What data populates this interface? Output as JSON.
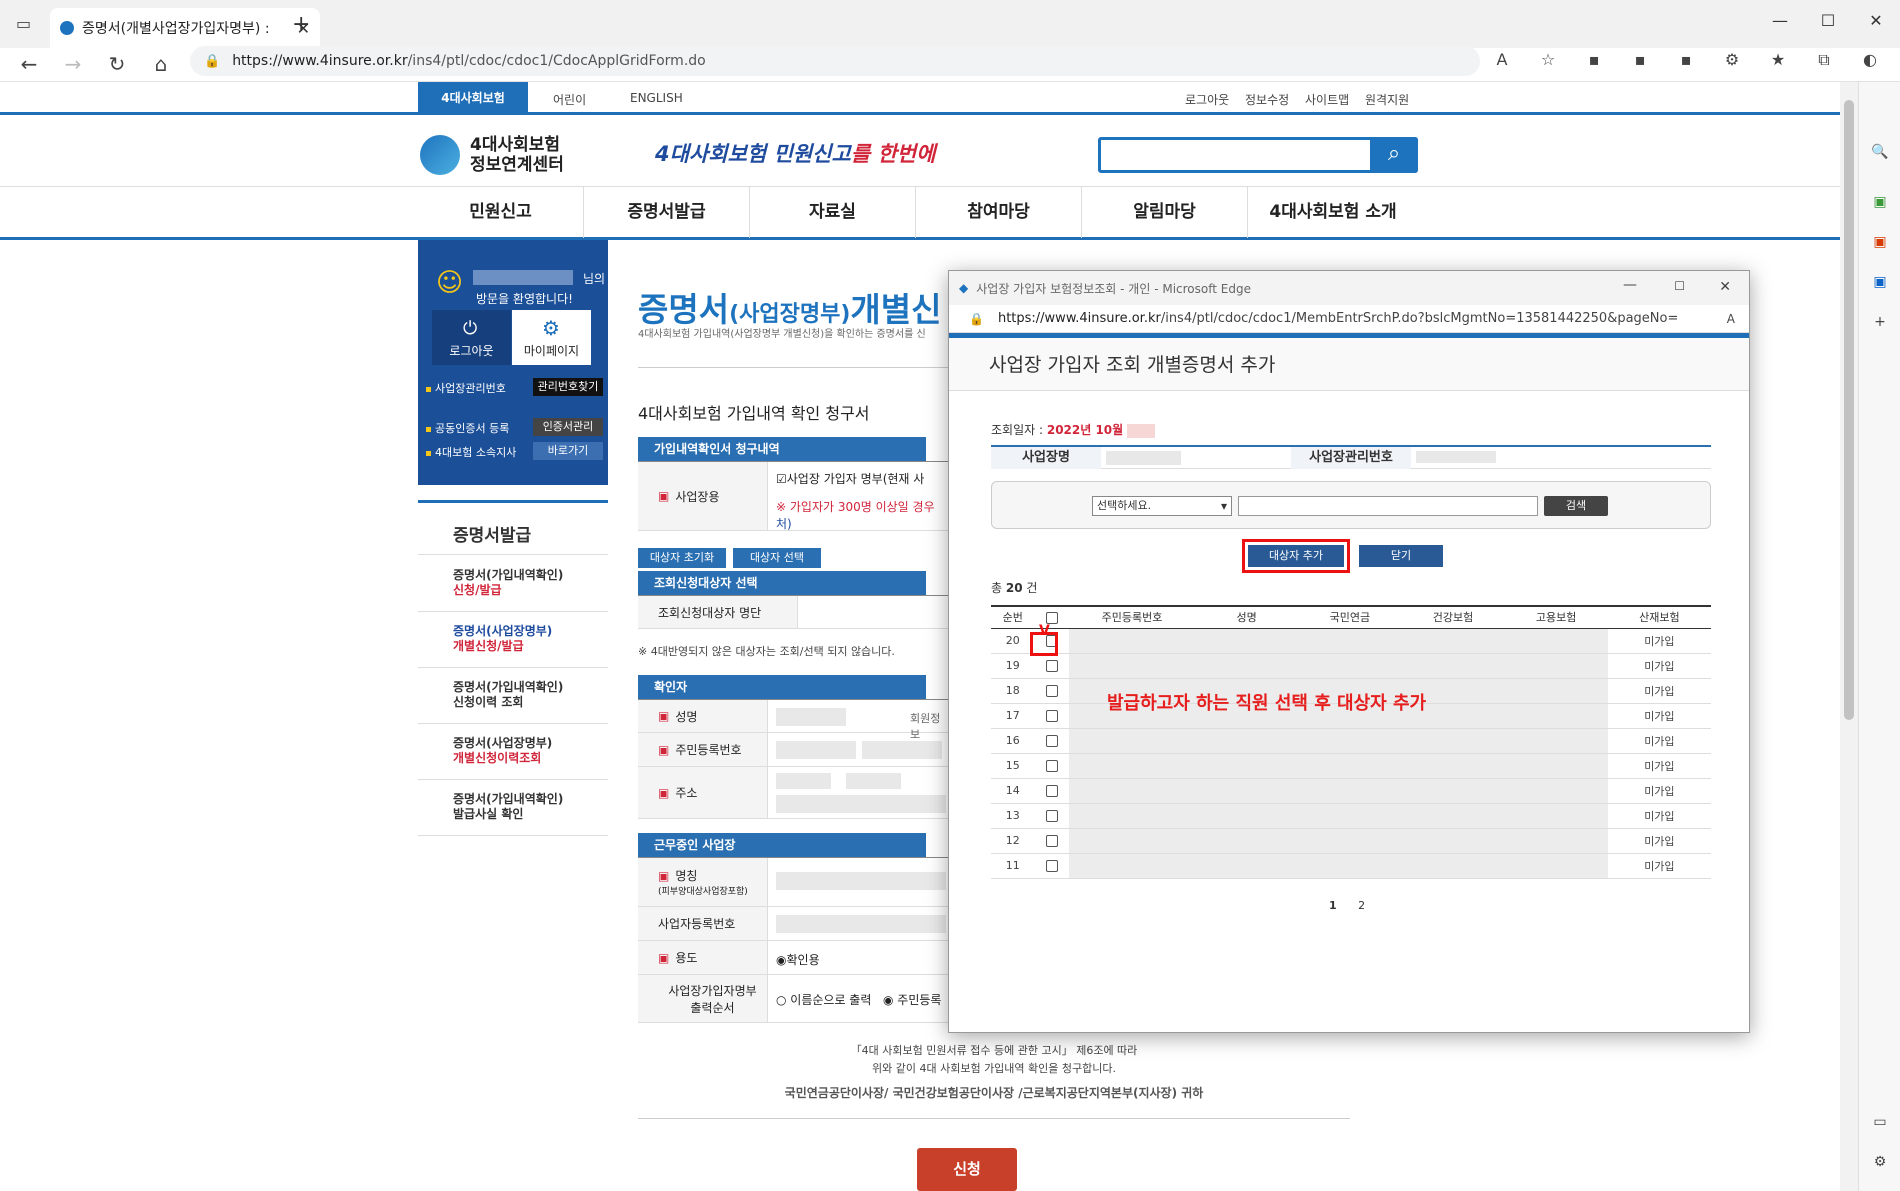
{
  "browser": {
    "tab_title": "증명서(개별사업장가입자명부) :",
    "url_host": "https://www.4insure.or.kr",
    "url_path": "/ins4/ptl/cdoc/cdoc1/CdocApplGridForm.do"
  },
  "site": {
    "top_tab": "4대사회보험",
    "top_link_kids": "어린이",
    "top_link_english": "ENGLISH",
    "top_right": [
      "로그아웃",
      "정보수정",
      "사이트맵",
      "원격지원"
    ],
    "logo_line1": "4대사회보험",
    "logo_line2": "정보연계센터",
    "slogan_main": "4대사회보험 민원신고",
    "slogan_suffix": "를 한번에",
    "nav": [
      "민원신고",
      "증명서발급",
      "자료실",
      "참여마당",
      "알림마당",
      "4대사회보험 소개"
    ]
  },
  "sidebar": {
    "suffix": "님의",
    "welcome": "방문을 환영합니다!",
    "logout_btn": "로그아웃",
    "mypage_btn": "마이페이지",
    "row1": "사업장관리번호",
    "row1_badge": "관리번호찾기",
    "row2": "공동인증서 등록",
    "row2_badge": "인증서관리",
    "row3": "4대보험 소속지사",
    "row3_badge": "바로가기",
    "menu_title": "증명서발급",
    "menu": [
      {
        "line1": "증명서(가입내역확인)",
        "line2": "신청/발급"
      },
      {
        "line1": "증명서(사업장명부)",
        "line2": "개별신청/발급"
      },
      {
        "line1": "증명서(가입내역확인)",
        "line2": "신청이력 조회"
      },
      {
        "line1": "증명서(사업장명부)",
        "line2": "개별신청이력조회"
      },
      {
        "line1": "증명서(가입내역확인)",
        "line2": "발급사실 확인"
      }
    ]
  },
  "main": {
    "title_big": "증명서",
    "title_small": "(사업장명부)",
    "title_rest": "개별신",
    "desc": "4대사회보험 가입내역(사업장명부 개별신청)을 확인하는 증명서를 신",
    "form_title": "4대사회보험 가입내역 확인 청구서",
    "sect1": "가입내역확인서 청구내역",
    "usage_label": "사업장용",
    "usage_check": "사업장 가입자 명부(현재 사",
    "usage_warn": "※ 가입자가 300명 이상일 경우",
    "usage_warn2": "처)",
    "btn_reset": "대상자 초기화",
    "btn_select": "대상자 선택",
    "sect2": "조회신청대상자 선택",
    "list_label": "조회신청대상자 명단",
    "note": "※ 4대반영되지 않은 대상자는 조회/선택 되지 않습니다.",
    "sect3": "확인자",
    "name_label": "성명",
    "name_extra": "회원정보",
    "rrn_label": "주민등록번호",
    "addr_label": "주소",
    "sect4": "근무중인 사업장",
    "company_label": "명칭",
    "company_sub": "(피부양대상사업장포함)",
    "bizno_label": "사업자등록번호",
    "purpose_label": "용도",
    "purpose_value": "확인용",
    "order_label1": "사업장가입자명부",
    "order_label2": "출력순서",
    "order_opt1": "이름순으로 출력",
    "order_opt2": "주민등록",
    "footer1": "「4대 사회보험 민원서류 접수 등에 관한 고시」 제6조에 따라",
    "footer2": "위와 같이 4대 사회보험 가입내역 확인을 청구합니다.",
    "footer3": "국민연금공단이사장/ 국민건강보험공단이사장 /근로복지공단지역본부(지사장) 귀하",
    "submit": "신청"
  },
  "popup": {
    "window_title": "사업장 가입자 보험정보조회 - 개인 - Microsoft Edge",
    "url_host": "https://www.4insure.or.kr",
    "url_path": "/ins4/ptl/cdoc/cdoc1/MembEntrSrchP.do?bslcMgmtNo=13581442250&pageNo=",
    "heading": "사업장 가입자 조회 개별증명서 추가",
    "date_label": "조회일자 : ",
    "date_value": "2022년 10월",
    "col_company": "사업장명",
    "col_mgmt": "사업장관리번호",
    "select_placeholder": "선택하세요.",
    "search_btn": "검색",
    "add_btn": "대상자 추가",
    "close_btn": "닫기",
    "count_prefix": "총 ",
    "count": "20",
    "count_suffix": " 건",
    "headers": [
      "순번",
      "",
      "주민등록번호",
      "성명",
      "국민연금",
      "건강보험",
      "고용보험",
      "산재보험"
    ],
    "rows": [
      {
        "no": "20",
        "status": "미가입"
      },
      {
        "no": "19",
        "status": "미가입"
      },
      {
        "no": "18",
        "status": "미가입"
      },
      {
        "no": "17",
        "status": "미가입"
      },
      {
        "no": "16",
        "status": "미가입"
      },
      {
        "no": "15",
        "status": "미가입"
      },
      {
        "no": "14",
        "status": "미가입"
      },
      {
        "no": "13",
        "status": "미가입"
      },
      {
        "no": "12",
        "status": "미가입"
      },
      {
        "no": "11",
        "status": "미가입"
      }
    ],
    "annotation": "발급하고자 하는 직원 선택 후 대상자 추가",
    "pages": [
      "1",
      "2"
    ]
  }
}
